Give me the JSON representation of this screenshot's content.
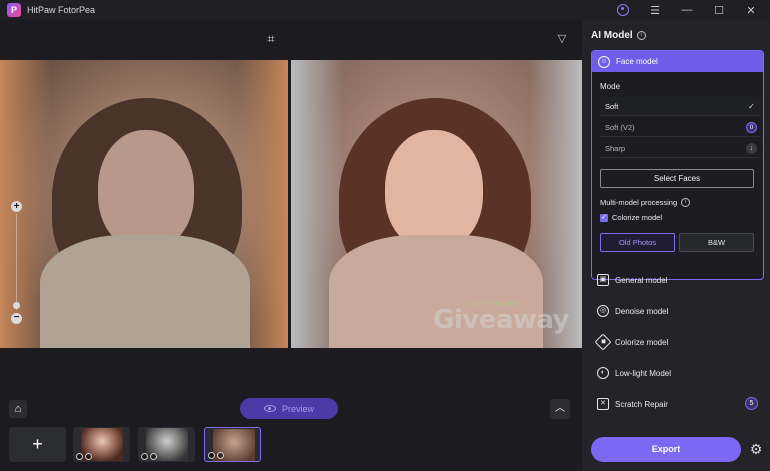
{
  "window": {
    "title": "HitPaw FotorPea",
    "logo_letter": "P"
  },
  "canvas": {
    "watermark_small": "SOFTWARE",
    "watermark_big": "Giveaway"
  },
  "bottom": {
    "preview_label": "Preview",
    "add_symbol": "+"
  },
  "panel": {
    "title": "AI Model",
    "face_model": {
      "label": "Face model",
      "mode_label": "Mode",
      "modes": [
        {
          "label": "Soft",
          "state": "selected"
        },
        {
          "label": "Soft (V2)",
          "state": "badge",
          "badge": "0"
        },
        {
          "label": "Sharp",
          "state": "download"
        }
      ],
      "select_faces": "Select Faces",
      "multi_model": "Multi-model processing",
      "colorize_model": "Colorize model",
      "old_photos": "Old Photos",
      "bw": "B&W"
    },
    "models": [
      {
        "label": "General model",
        "icon": "image-icon"
      },
      {
        "label": "Denoise model",
        "icon": "denoise-icon"
      },
      {
        "label": "Colorize model",
        "icon": "colorize-icon"
      },
      {
        "label": "Low-light Model",
        "icon": "lowlight-icon"
      },
      {
        "label": "Scratch Repair",
        "icon": "scratch-icon",
        "badge": "5"
      }
    ],
    "export_label": "Export"
  },
  "colors": {
    "accent": "#7c68f2",
    "panel_bg": "#232329",
    "app_bg": "#1b1b20"
  }
}
